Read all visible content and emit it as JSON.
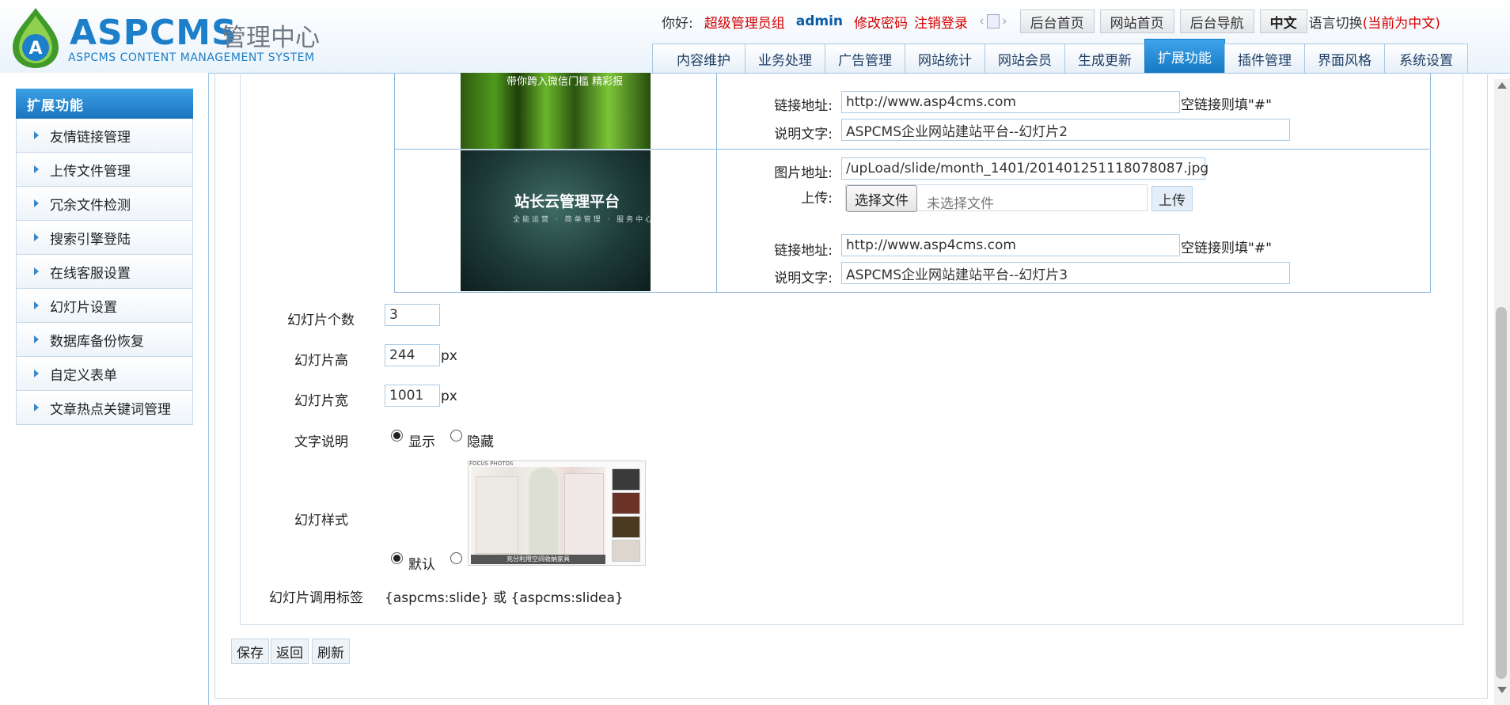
{
  "header": {
    "logo_text": "ASPCMS",
    "logo_cn": "管理中心",
    "logo_sub": "ASPCMS CONTENT MANAGEMENT SYSTEM",
    "greeting": "你好:",
    "group": "超级管理员组",
    "user": "admin",
    "change_password": "修改密码",
    "logout": "注销登录",
    "buttons": [
      "后台首页",
      "网站首页",
      "后台导航",
      "中文"
    ],
    "lang_switch": "语言切换",
    "lang_current_open": "(",
    "lang_current": "当前为中文",
    "lang_current_close": ")",
    "colors": {
      "brand": "#1d7fc9",
      "alert": "#d40000"
    }
  },
  "nav": {
    "tabs": [
      "内容维护",
      "业务处理",
      "广告管理",
      "网站统计",
      "网站会员",
      "生成更新",
      "扩展功能",
      "插件管理",
      "界面风格",
      "系统设置"
    ],
    "active": "扩展功能"
  },
  "sidebar": {
    "title": "扩展功能",
    "items": [
      "友情链接管理",
      "上传文件管理",
      "冗余文件检测",
      "搜索引擎登陆",
      "在线客服设置",
      "幻灯片设置",
      "数据库备份恢复",
      "自定义表单",
      "文章热点关键词管理"
    ]
  },
  "slides": {
    "labels": {
      "link": "链接地址:",
      "desc": "说明文字:",
      "image": "图片地址:",
      "upload": "上传:",
      "empty_link_hint": "空链接则填\"#\"",
      "choose_file": "选择文件",
      "no_file": "未选择文件",
      "upload_btn": "上传"
    },
    "slide2": {
      "image_text": "带你跨入微信门槛  精彩报",
      "link": "http://www.asp4cms.com",
      "desc": "ASPCMS企业网站建站平台--幻灯片2"
    },
    "slide3": {
      "image_logo": "站长云管理平台",
      "image_sub": "全能运营 · 简单管理 · 服务中心 · 功能完善",
      "image_path": "/upLoad/slide/month_1401/201401251118078087.jpg",
      "link": "http://www.asp4cms.com",
      "desc": "ASPCMS企业网站建站平台--幻灯片3"
    }
  },
  "settings": {
    "count_label": "幻灯片个数",
    "count": "3",
    "height_label": "幻灯片高",
    "height": "244",
    "width_label": "幻灯片宽",
    "width": "1001",
    "unit": "px",
    "text_label": "文字说明",
    "show": "显示",
    "hide": "隐藏",
    "style_label": "幻灯样式",
    "style_default": "默认",
    "thumb_brand": "FOCUS PHOTOS",
    "thumb_caption": "充分利用空间收纳家具",
    "tag_label": "幻灯片调用标签",
    "tag_value": "{aspcms:slide} 或 {aspcms:slidea}"
  },
  "footer_buttons": [
    "保存",
    "返回",
    "刷新"
  ]
}
